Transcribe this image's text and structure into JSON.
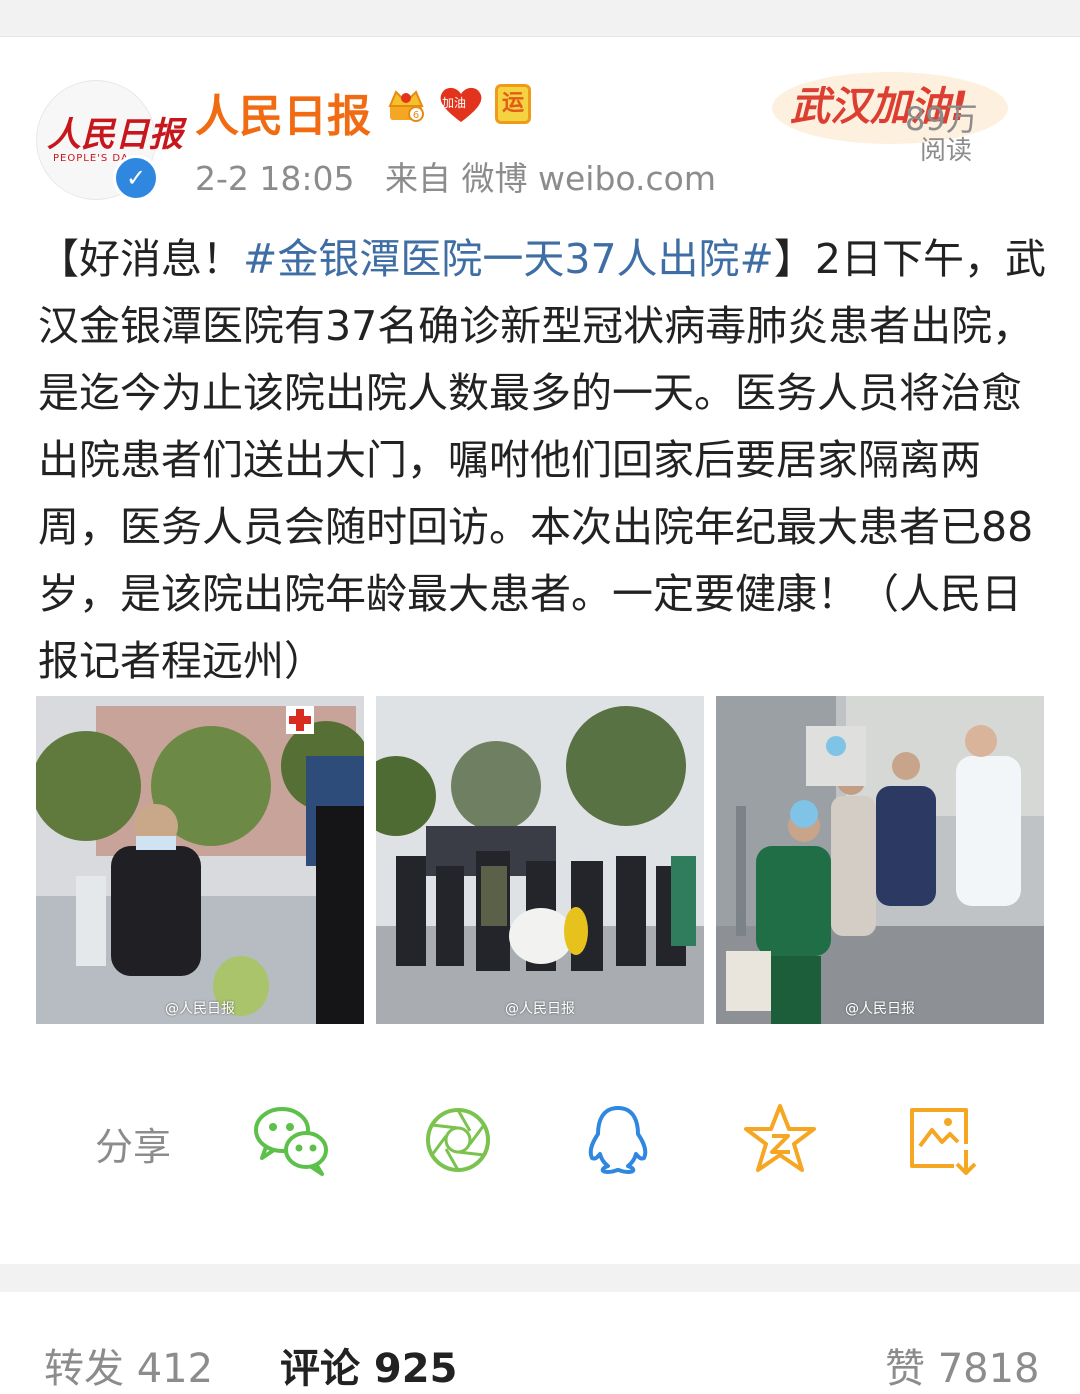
{
  "post": {
    "author": "人民日报",
    "avatar_text": "人民日报",
    "avatar_subtext": "PEOPLE'S DA",
    "yun_badge": "运",
    "heart_badge": "加油",
    "time": "2-2 18:05",
    "source": "来自 微博 weibo.com",
    "banner": "武汉加油!",
    "reads_count": "89万",
    "reads_label": "阅读",
    "text": {
      "prefix": "【好消息！",
      "hashtag": "#金银潭医院一天37人出院#",
      "body": "】2日下午，武汉金银潭医院有37名确诊新型冠状病毒肺炎患者出院，是迄今为止该院出院人数最多的一天。医务人员将治愈出院患者们送出大门，嘱咐他们回家后要居家隔离两周，医务人员会随时回访。本次出院年纪最大患者已88岁，是该院出院年龄最大患者。一定要健康！（人民日报记者程远州）"
    },
    "images": [
      {
        "watermark": "@人民日报"
      },
      {
        "watermark": "@人民日报"
      },
      {
        "watermark": "@人民日报"
      }
    ]
  },
  "share": {
    "label": "分享",
    "icons": [
      "wechat-icon",
      "moments-icon",
      "qq-icon",
      "qzone-icon",
      "save-image-icon"
    ]
  },
  "tabs": {
    "repost": "转发 412",
    "comment": "评论 925",
    "like": "赞 7818"
  },
  "colors": {
    "author": "#f06b12",
    "hashtag": "#3f6ea5",
    "icon_green": "#5cc04a",
    "icon_blue": "#2f87e0",
    "icon_yellow": "#f5a623",
    "banner_red": "#d92b20"
  }
}
